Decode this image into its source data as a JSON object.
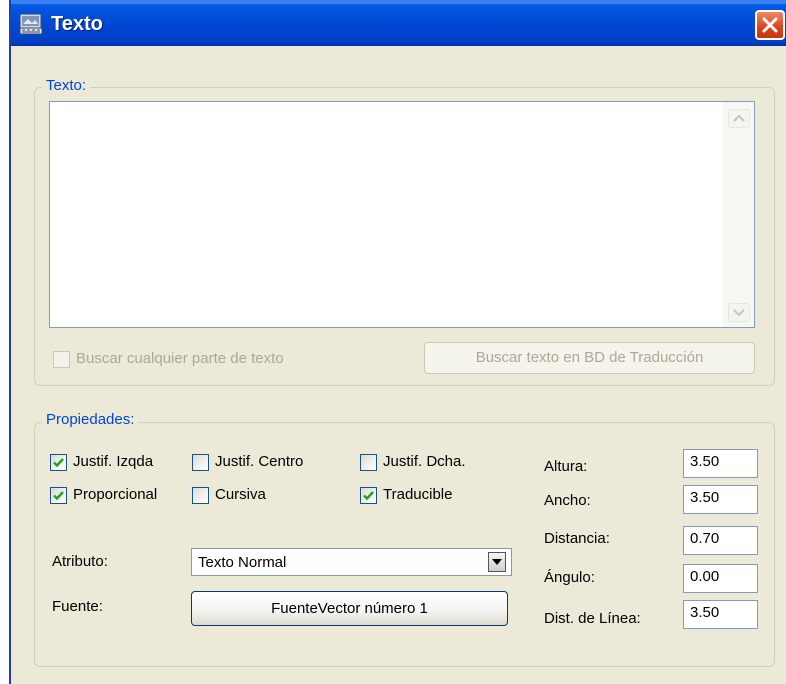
{
  "window": {
    "title": "Texto",
    "icon": "app-icon",
    "close_icon": "close-icon"
  },
  "text_group": {
    "legend": "Texto:",
    "text_value": "",
    "search_any_part_label": "Buscar cualquier parte de texto",
    "search_any_part_checked": false,
    "search_any_part_enabled": false,
    "search_db_button": "Buscar texto en BD de Traducción",
    "search_db_enabled": false
  },
  "properties_group": {
    "legend": "Propiedades:",
    "checkboxes": [
      {
        "label": "Justif. Izqda",
        "checked": true
      },
      {
        "label": "Justif. Centro",
        "checked": false
      },
      {
        "label": "Justif. Dcha.",
        "checked": false
      },
      {
        "label": "Proporcional",
        "checked": true
      },
      {
        "label": "Cursiva",
        "checked": false
      },
      {
        "label": "Traducible",
        "checked": true
      }
    ],
    "attribute_label": "Atributo:",
    "attribute_value": "Texto Normal",
    "font_label": "Fuente:",
    "font_button": "FuenteVector número 1",
    "fields": [
      {
        "label": "Altura:",
        "value": "3.50"
      },
      {
        "label": "Ancho:",
        "value": "3.50"
      },
      {
        "label": "Distancia:",
        "value": "0.70"
      },
      {
        "label": "Ángulo:",
        "value": "0.00"
      },
      {
        "label": "Dist. de Línea:",
        "value": "3.50"
      }
    ]
  },
  "colors": {
    "titlebar": "#0247d4",
    "close_button": "#d9441c",
    "dialog_bg": "#ece9d8",
    "legend_text": "#0046d5"
  }
}
